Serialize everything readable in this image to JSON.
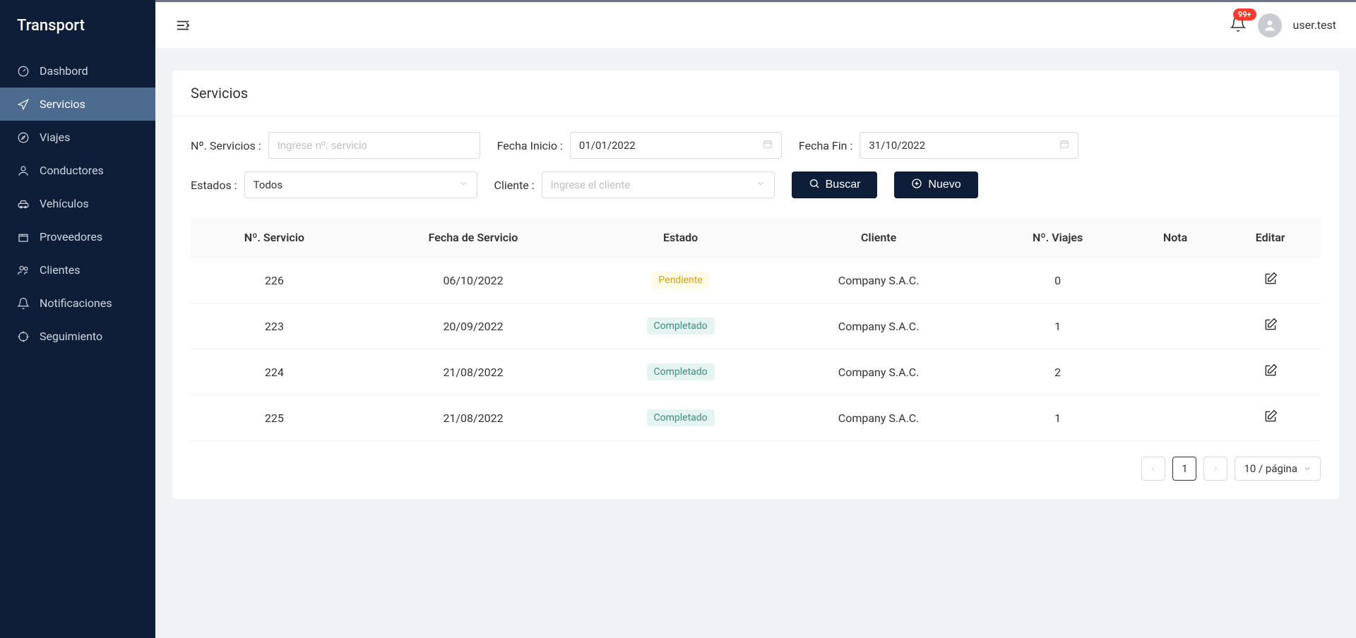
{
  "brand": "Transport",
  "sidebar": {
    "items": [
      {
        "label": "Dashbord",
        "icon": "gauge-icon"
      },
      {
        "label": "Servicios",
        "icon": "send-icon",
        "active": true
      },
      {
        "label": "Viajes",
        "icon": "compass-icon"
      },
      {
        "label": "Conductores",
        "icon": "user-icon"
      },
      {
        "label": "Vehículos",
        "icon": "car-icon"
      },
      {
        "label": "Proveedores",
        "icon": "box-icon"
      },
      {
        "label": "Clientes",
        "icon": "users-icon"
      },
      {
        "label": "Notificaciones",
        "icon": "bell-icon"
      },
      {
        "label": "Seguimiento",
        "icon": "crosshair-icon"
      }
    ]
  },
  "topbar": {
    "badge": "99+",
    "username": "user.test"
  },
  "page": {
    "title": "Servicios"
  },
  "filters": {
    "numero_label": "Nº. Servicios :",
    "numero_placeholder": "Ingrese nº. servicio",
    "fecha_inicio_label": "Fecha Inicio :",
    "fecha_inicio_value": "01/01/2022",
    "fecha_fin_label": "Fecha Fin :",
    "fecha_fin_value": "31/10/2022",
    "estados_label": "Estados :",
    "estados_value": "Todos",
    "cliente_label": "Cliente :",
    "cliente_placeholder": "Ingrese el cliente",
    "buscar_label": "Buscar",
    "nuevo_label": "Nuevo"
  },
  "table": {
    "headers": [
      "Nº. Servicio",
      "Fecha de Servicio",
      "Estado",
      "Cliente",
      "Nº. Viajes",
      "Nota",
      "Editar"
    ],
    "rows": [
      {
        "num": "226",
        "fecha": "06/10/2022",
        "estado": "Pendiente",
        "estado_class": "pendiente",
        "cliente": "Company S.A.C.",
        "viajes": "0",
        "nota": ""
      },
      {
        "num": "223",
        "fecha": "20/09/2022",
        "estado": "Completado",
        "estado_class": "completado",
        "cliente": "Company S.A.C.",
        "viajes": "1",
        "nota": ""
      },
      {
        "num": "224",
        "fecha": "21/08/2022",
        "estado": "Completado",
        "estado_class": "completado",
        "cliente": "Company S.A.C.",
        "viajes": "2",
        "nota": ""
      },
      {
        "num": "225",
        "fecha": "21/08/2022",
        "estado": "Completado",
        "estado_class": "completado",
        "cliente": "Company S.A.C.",
        "viajes": "1",
        "nota": ""
      }
    ]
  },
  "pagination": {
    "current": "1",
    "page_size_label": "10 / página"
  }
}
